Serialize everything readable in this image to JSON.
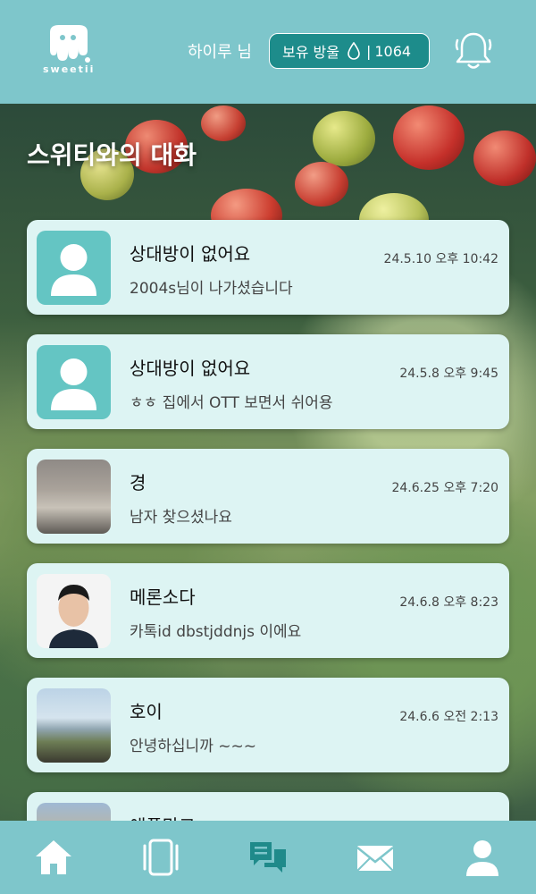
{
  "header": {
    "logo_text": "sweetii",
    "username": "하이루 님",
    "drops_label": "보유 방울",
    "drops_separator": "|",
    "drops_count": "1064"
  },
  "page": {
    "title": "스위티와의 대화"
  },
  "chats": [
    {
      "name": "상대방이 없어요",
      "message": "2004s님이 나가셨습니다",
      "time": "24.5.10 오후 10:42",
      "avatar": "default-avatar"
    },
    {
      "name": "상대방이 없어요",
      "message": "ㅎㅎ 집에서 OTT 보면서 쉬어용",
      "time": "24.5.8 오후 9:45",
      "avatar": "default-avatar"
    },
    {
      "name": "경",
      "message": "남자 찾으셨나요",
      "time": "24.6.25 오후 7:20",
      "avatar": "photo"
    },
    {
      "name": "메론소다",
      "message": "카톡id dbstjddnjs 이에요",
      "time": "24.6.8 오후 8:23",
      "avatar": "photo"
    },
    {
      "name": "호이",
      "message": "안녕하십니까 ~~~",
      "time": "24.6.6 오전 2:13",
      "avatar": "photo"
    },
    {
      "name": "애플망고",
      "message": "",
      "time": "",
      "avatar": "photo"
    }
  ],
  "nav": [
    "home-icon",
    "cards-icon",
    "chat-icon",
    "mail-icon",
    "profile-icon"
  ],
  "colors": {
    "primary": "#7ec6cb",
    "accent": "#1d8c8b",
    "card": "#ddf4f3",
    "active_icon": "#1f8a8a"
  }
}
